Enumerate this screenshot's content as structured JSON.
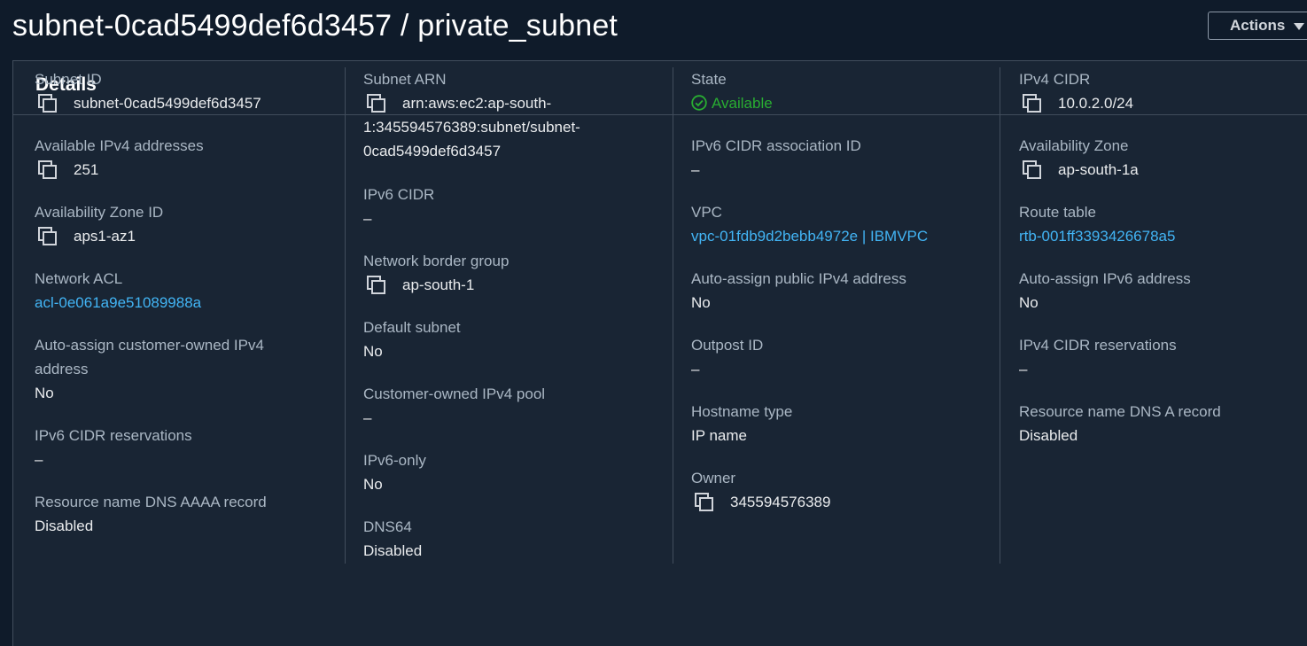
{
  "header": {
    "title": "subnet-0cad5499def6d3457 / private_subnet",
    "actions_label": "Actions"
  },
  "panel": {
    "title": "Details"
  },
  "colors": {
    "link": "#42b4f4",
    "success": "#29ad32",
    "background": "#0f1b2a",
    "panel": "#192534"
  },
  "col1": {
    "subnet_id": {
      "label": "Subnet ID",
      "value": "subnet-0cad5499def6d3457",
      "icon": "copy-icon"
    },
    "available_ipv4": {
      "label": "Available IPv4 addresses",
      "value": "251",
      "icon": "copy-icon"
    },
    "az_id": {
      "label": "Availability Zone ID",
      "value": "aps1-az1",
      "icon": "copy-icon"
    },
    "network_acl": {
      "label": "Network ACL",
      "value": "acl-0e061a9e51089988a"
    },
    "customer_owned": {
      "label": "Auto-assign customer-owned IPv4 address",
      "value": "No"
    },
    "ipv6_reservations": {
      "label": "IPv6 CIDR reservations",
      "value": "–"
    },
    "dns_aaaa": {
      "label": "Resource name DNS AAAA record",
      "value": "Disabled"
    }
  },
  "col2": {
    "subnet_arn": {
      "label": "Subnet ARN",
      "line1": "arn:aws:ec2:ap-south-",
      "line2": "1:345594576389:subnet/subnet-",
      "line3": "0cad5499def6d3457",
      "icon": "copy-icon"
    },
    "ipv6_cidr": {
      "label": "IPv6 CIDR",
      "value": "–"
    },
    "border_group": {
      "label": "Network border group",
      "value": "ap-south-1",
      "icon": "copy-icon"
    },
    "default_subnet": {
      "label": "Default subnet",
      "value": "No"
    },
    "customer_pool": {
      "label": "Customer-owned IPv4 pool",
      "value": "–"
    },
    "ipv6_only": {
      "label": "IPv6-only",
      "value": "No"
    },
    "dns64": {
      "label": "DNS64",
      "value": "Disabled"
    }
  },
  "col3": {
    "state": {
      "label": "State",
      "value": "Available",
      "icon": "check-circle-icon"
    },
    "ipv6_assoc": {
      "label": "IPv6 CIDR association ID",
      "value": "–"
    },
    "vpc": {
      "label": "VPC",
      "value": "vpc-01fdb9d2bebb4972e | IBMVPC"
    },
    "auto_public": {
      "label": "Auto-assign public IPv4 address",
      "value": "No"
    },
    "outpost": {
      "label": "Outpost ID",
      "value": "–"
    },
    "hostname": {
      "label": "Hostname type",
      "value": "IP name"
    },
    "owner": {
      "label": "Owner",
      "value": "345594576389",
      "icon": "copy-icon"
    }
  },
  "col4": {
    "ipv4_cidr": {
      "label": "IPv4 CIDR",
      "value": "10.0.2.0/24",
      "icon": "copy-icon"
    },
    "az": {
      "label": "Availability Zone",
      "value": "ap-south-1a",
      "icon": "copy-icon"
    },
    "route_table": {
      "label": "Route table",
      "value": "rtb-001ff3393426678a5"
    },
    "auto_ipv6": {
      "label": "Auto-assign IPv6 address",
      "value": "No"
    },
    "ipv4_reservations": {
      "label": "IPv4 CIDR reservations",
      "value": "–"
    },
    "dns_a": {
      "label": "Resource name DNS A record",
      "value": "Disabled"
    }
  }
}
